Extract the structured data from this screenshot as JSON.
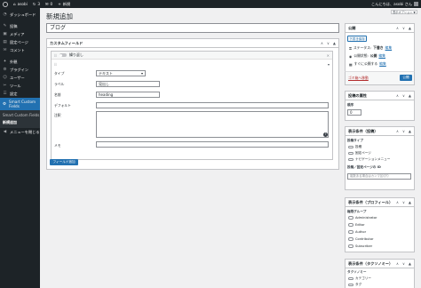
{
  "adminbar": {
    "site": "asobi",
    "updates": "3",
    "comments": "0",
    "new": "新規",
    "greeting": "こんにちは、asobi さん"
  },
  "sidebar": {
    "items": [
      {
        "label": "ダッシュボード",
        "icon": "◔"
      },
      {
        "label": "投稿",
        "icon": "✎"
      },
      {
        "label": "メディア",
        "icon": "▣"
      },
      {
        "label": "固定ページ",
        "icon": "▤"
      },
      {
        "label": "コメント",
        "icon": "✉"
      },
      {
        "label": "外観",
        "icon": "✦"
      },
      {
        "label": "プラグイン",
        "icon": "⚙"
      },
      {
        "label": "ユーザー",
        "icon": "☺"
      },
      {
        "label": "ツール",
        "icon": "✂"
      },
      {
        "label": "設定",
        "icon": "☰"
      }
    ],
    "current": "Smart Custom Fields",
    "submenu": [
      "Smart Custom Fields",
      "新規追加"
    ],
    "collapse": "メニューを閉じる"
  },
  "screen_options": "表示オプション ▼",
  "page_title": "新規追加",
  "post_title": "ブログ",
  "fields_box": {
    "title": "カスタムフィールド",
    "group_label": "繰り返し",
    "type_label": "タイプ",
    "type_value": "テキスト",
    "label_label": "ラベル",
    "label_value": "見出し",
    "name_label": "名前",
    "name_value": "heading",
    "default_label": "デフォルト",
    "notes_label": "注釈",
    "instruction_label": "メモ",
    "add_button": "フィールド追加"
  },
  "publish": {
    "title": "公開",
    "preview_button": "下書き保存",
    "status_label": "ステータス:",
    "status_value": "下書き",
    "status_edit": "編集",
    "visibility_label": "公開状態:",
    "visibility_value": "公開",
    "visibility_edit": "編集",
    "schedule_label": "すぐに公開する",
    "schedule_edit": "編集",
    "trash": "ゴミ箱へ移動",
    "publish_button": "公開"
  },
  "attributes": {
    "title": "投稿の属性",
    "order_label": "順序",
    "order_value": "0"
  },
  "display_post": {
    "title": "表示条件（投稿）",
    "types_label": "投稿タイプ",
    "types": [
      "投稿",
      "固定ページ",
      "ナビゲーションメニュー"
    ],
    "ids_label": "投稿／固定ページの ID",
    "ids_placeholder": "複数ある場合はカンマ区切り"
  },
  "display_profile": {
    "title": "表示条件（プロフィール）",
    "roles_label": "権限グループ",
    "roles": [
      "Administrator",
      "Editor",
      "Author",
      "Contributor",
      "Subscriber"
    ]
  },
  "display_tax": {
    "title": "表示条件（タクソノミー）",
    "tax_label": "タクソノミー",
    "taxes": [
      "カテゴリー",
      "タグ"
    ]
  },
  "colors": {
    "accent": "#2271b1",
    "sidebar": "#1d2327"
  }
}
